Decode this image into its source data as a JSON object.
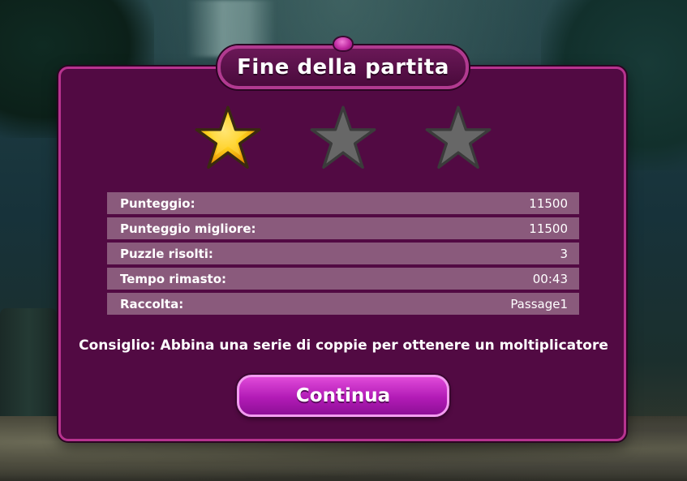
{
  "dialog": {
    "title": "Fine della partita",
    "stars": [
      {
        "icon": "star-filled-icon",
        "filled": true
      },
      {
        "icon": "star-empty-icon",
        "filled": false
      },
      {
        "icon": "star-empty-icon",
        "filled": false
      }
    ],
    "stars_earned": 1,
    "stars_total": 3,
    "stats": [
      {
        "label": "Punteggio:",
        "value": "11500"
      },
      {
        "label": "Punteggio migliore:",
        "value": "11500"
      },
      {
        "label": "Puzzle risolti:",
        "value": "3"
      },
      {
        "label": "Tempo rimasto:",
        "value": "00:43"
      },
      {
        "label": "Raccolta:",
        "value": "Passage1"
      }
    ],
    "tip": "Consiglio: Abbina una serie di coppie per ottenere un moltiplicatore",
    "continue_label": "Continua"
  },
  "colors": {
    "panel": "#520a43",
    "panel_border": "#b7338f",
    "row": "#8a5a7c",
    "button": "#c42fc6",
    "star_gold": "#f7b500",
    "star_empty": "#666666"
  }
}
